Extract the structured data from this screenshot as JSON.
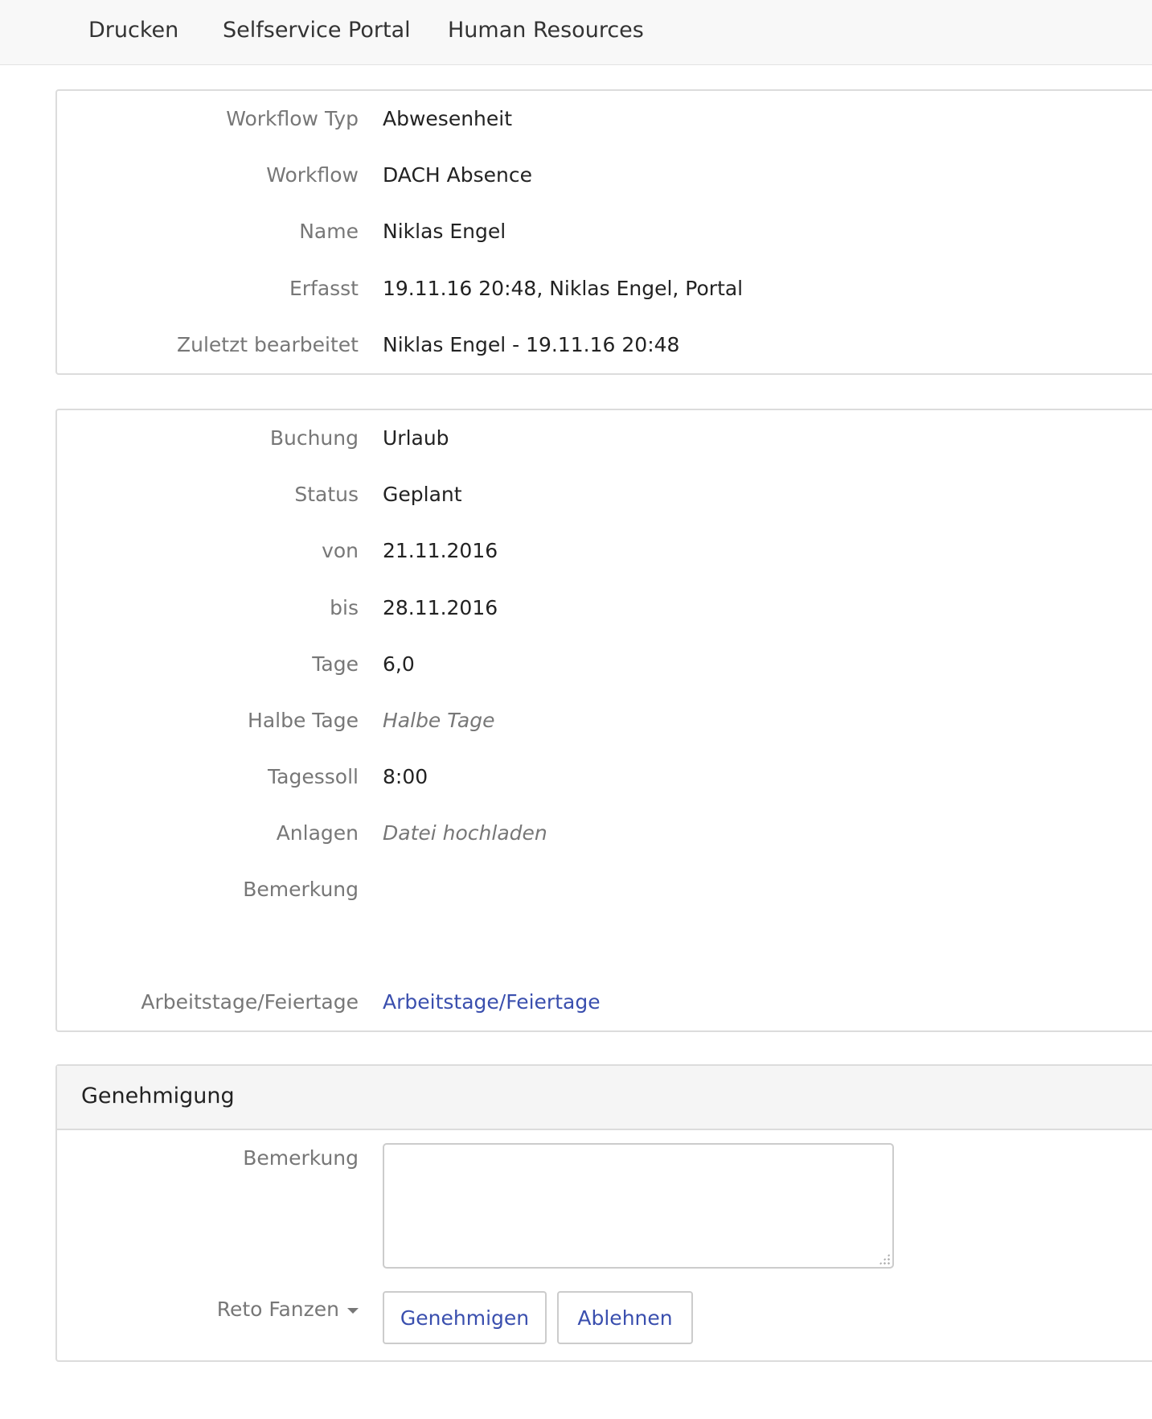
{
  "nav": {
    "items": [
      {
        "label": "Drucken"
      },
      {
        "label": "Selfservice Portal"
      },
      {
        "label": "Human Resources"
      }
    ]
  },
  "workflow_panel": {
    "rows": [
      {
        "label": "Workflow Typ",
        "value": "Abwesenheit"
      },
      {
        "label": "Workflow",
        "value": "DACH Absence"
      },
      {
        "label": "Name",
        "value": "Niklas Engel"
      },
      {
        "label": "Erfasst",
        "value": "19.11.16 20:48, Niklas Engel, Portal"
      },
      {
        "label": "Zuletzt bearbeitet",
        "value": "Niklas Engel - 19.11.16 20:48"
      }
    ]
  },
  "booking_panel": {
    "rows": [
      {
        "label": "Buchung",
        "value": "Urlaub"
      },
      {
        "label": "Status",
        "value": "Geplant"
      },
      {
        "label": "von",
        "value": "21.11.2016"
      },
      {
        "label": "bis",
        "value": "28.11.2016"
      },
      {
        "label": "Tage",
        "value": "6,0"
      },
      {
        "label": "Halbe Tage",
        "placeholder": "Halbe Tage"
      },
      {
        "label": "Tagessoll",
        "value": "8:00"
      },
      {
        "label": "Anlagen",
        "placeholder": "Datei hochladen"
      },
      {
        "label": "Bemerkung",
        "value": ""
      },
      {
        "label": "Arbeitstage/Feiertage",
        "link": "Arbeitstage/Feiertage"
      }
    ]
  },
  "approval_panel": {
    "title": "Genehmigung",
    "remark_label": "Bemerkung",
    "remark_value": "",
    "approver": "Reto Fanzen",
    "approve_label": "Genehmigen",
    "reject_label": "Ablehnen"
  },
  "colors": {
    "link": "#3a4fae",
    "label": "#777777",
    "border": "#dcdcdc"
  }
}
